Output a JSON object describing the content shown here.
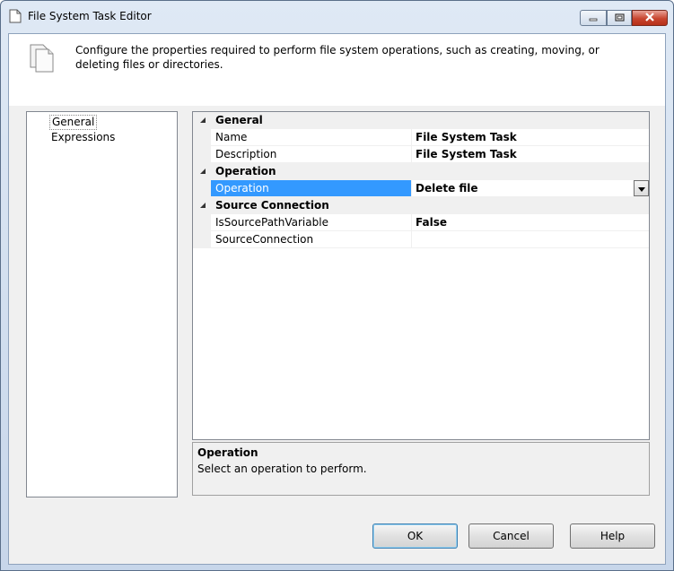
{
  "window": {
    "title": "File System Task Editor"
  },
  "header": {
    "description": "Configure the properties required to perform file system operations, such as creating, moving, or deleting files or directories.",
    "icon": "documents-icon"
  },
  "nav": {
    "items": [
      {
        "label": "General",
        "selected": true
      },
      {
        "label": "Expressions",
        "selected": false
      }
    ]
  },
  "grid": {
    "categories": [
      {
        "label": "General",
        "properties": [
          {
            "name": "Name",
            "value": "File System Task"
          },
          {
            "name": "Description",
            "value": "File System Task"
          }
        ]
      },
      {
        "label": "Operation",
        "properties": [
          {
            "name": "Operation",
            "value": "Delete file",
            "selected": true,
            "dropdown": true
          }
        ]
      },
      {
        "label": "Source Connection",
        "properties": [
          {
            "name": "IsSourcePathVariable",
            "value": "False"
          },
          {
            "name": "SourceConnection",
            "value": ""
          }
        ]
      }
    ]
  },
  "description_panel": {
    "title": "Operation",
    "text": "Select an operation to perform."
  },
  "buttons": {
    "ok": "OK",
    "cancel": "Cancel",
    "help": "Help"
  },
  "colors": {
    "selection": "#3399ff",
    "close_button": "#c8452f"
  }
}
